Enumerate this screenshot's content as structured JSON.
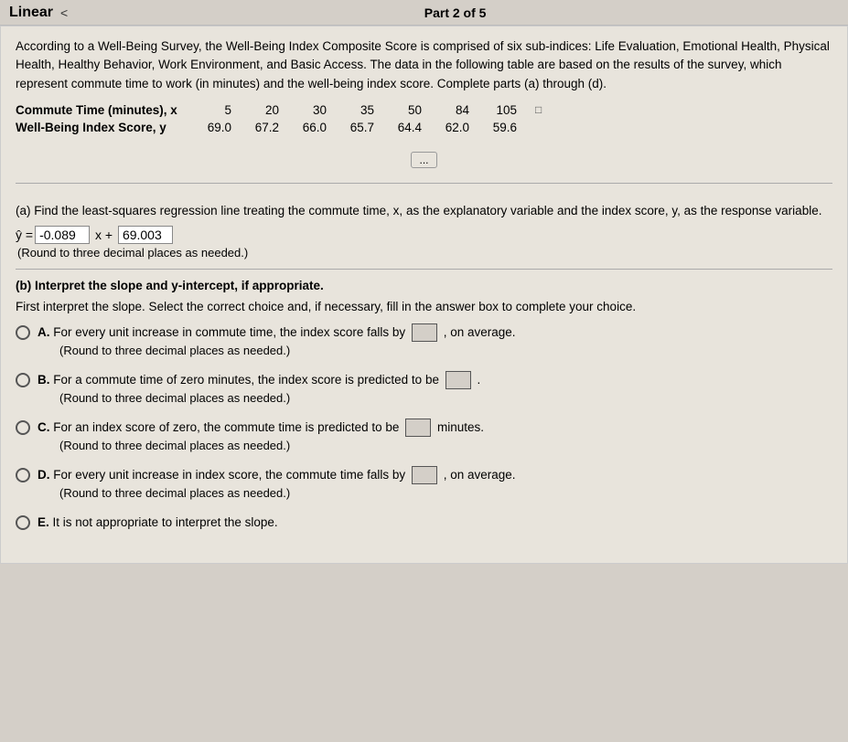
{
  "topbar": {
    "title": "Linear",
    "nav_back": "<",
    "part_label": "Part 2 of 5"
  },
  "description": {
    "paragraph": "According to a Well-Being Survey, the Well-Being Index Composite Score is comprised of six sub-indices: Life Evaluation, Emotional Health, Physical Health, Healthy Behavior, Work Environment, and Basic Access. The data in the following table are based on the results of the survey, which represent commute time to work (in minutes) and the well-being index score. Complete parts (a) through (d).",
    "row_label_x": "Commute Time (minutes), x",
    "row_label_y": "Well-Being Index Score, y",
    "x_values": [
      "5",
      "20",
      "30",
      "35",
      "50",
      "84",
      "105"
    ],
    "y_values": [
      "69.0",
      "67.2",
      "66.0",
      "65.7",
      "64.4",
      "62.0",
      "59.6"
    ]
  },
  "expand_button": "...",
  "section_a": {
    "title": "(a) Find the least-squares regression line treating the commute time, x, as the explanatory variable and the index score, y, as the response variable.",
    "equation_prefix": "ŷ =",
    "equation_coeff": "-0.089",
    "equation_x": "x +",
    "equation_intercept": "69.003",
    "round_note": "(Round to three decimal places as needed.)"
  },
  "section_b": {
    "title": "(b) Interpret the slope and y-intercept, if appropriate.",
    "instruction": "First interpret the slope. Select the correct choice and, if necessary, fill in the answer box to complete your choice.",
    "options": [
      {
        "letter": "A.",
        "text_before": "For every unit increase in commute time, the index score falls by",
        "has_box": true,
        "text_after": ", on average.",
        "note": "(Round to three decimal places as needed.)"
      },
      {
        "letter": "B.",
        "text_before": "For a commute time of zero minutes, the index score is predicted to be",
        "has_box": true,
        "text_after": ".",
        "note": "(Round to three decimal places as needed.)"
      },
      {
        "letter": "C.",
        "text_before": "For an index score of zero, the commute time is predicted to be",
        "has_box": true,
        "text_after": "minutes.",
        "note": "(Round to three decimal places as needed.)"
      },
      {
        "letter": "D.",
        "text_before": "For every unit increase in index score, the commute time falls by",
        "has_box": true,
        "text_after": ", on average.",
        "note": "(Round to three decimal places as needed.)"
      },
      {
        "letter": "E.",
        "text_before": "It is not appropriate to interpret the slope.",
        "has_box": false,
        "text_after": "",
        "note": ""
      }
    ]
  }
}
